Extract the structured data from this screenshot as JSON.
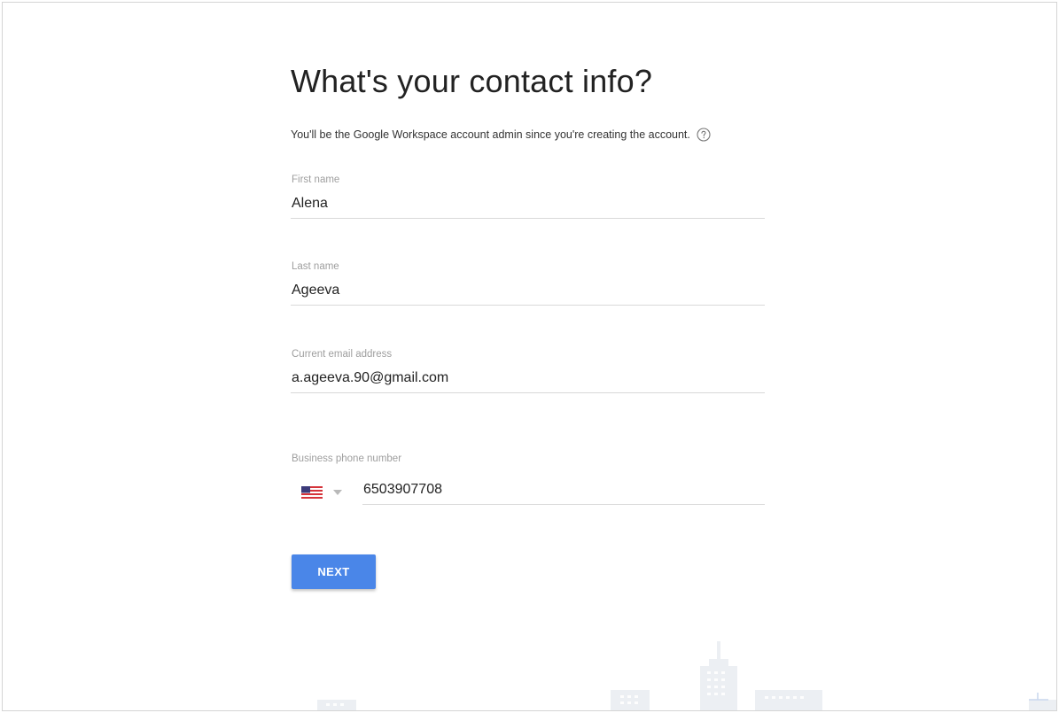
{
  "title": "What's your contact info?",
  "subtitle": "You'll be the Google Workspace account admin since you're creating the account.",
  "help_icon": "question-circle-icon",
  "fields": {
    "first_name": {
      "label": "First name",
      "value": "Alena"
    },
    "last_name": {
      "label": "Last name",
      "value": "Ageeva"
    },
    "email": {
      "label": "Current email address",
      "value": "a.ageeva.90@gmail.com"
    },
    "phone": {
      "label": "Business phone number",
      "country_flag_icon": "us-flag-icon",
      "dropdown_icon": "triangle-down-icon",
      "value": "6503907708"
    }
  },
  "next_button": {
    "label": "NEXT"
  },
  "colors": {
    "accent": "#4a86e8",
    "title_text": "#222222",
    "label_text": "#9e9e9e",
    "underline": "#d9d9d9",
    "skyline": "#e9ecf0"
  }
}
